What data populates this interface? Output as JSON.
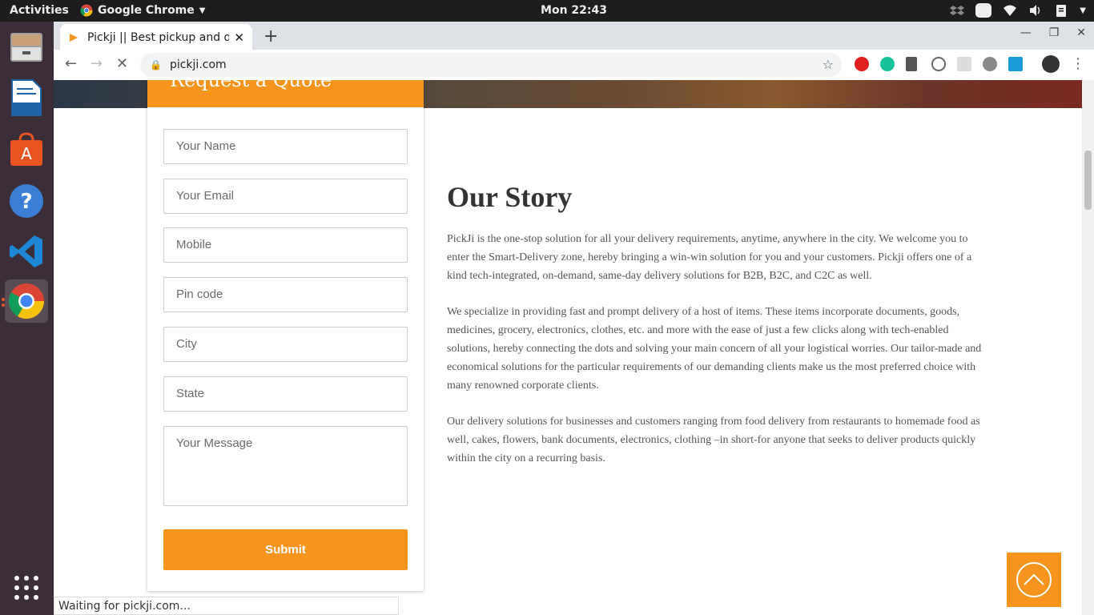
{
  "topbar": {
    "activities": "Activities",
    "app_name": "Google Chrome",
    "clock": "Mon 22:43"
  },
  "dock": {
    "items": [
      {
        "name": "Files"
      },
      {
        "name": "LibreOffice Writer"
      },
      {
        "name": "Ubuntu Software"
      },
      {
        "name": "Help"
      },
      {
        "name": "Visual Studio Code"
      },
      {
        "name": "Google Chrome"
      }
    ]
  },
  "browser": {
    "tab_title": "Pickji || Best pickup and de",
    "url": "pickji.com",
    "status": "Waiting for pickji.com..."
  },
  "form": {
    "heading": "Request a Quote",
    "fields": [
      "Your Name",
      "Your Email",
      "Mobile",
      "Pin code",
      "City",
      "State"
    ],
    "message_placeholder": "Your Message",
    "submit": "Submit"
  },
  "story": {
    "title": "Our Story",
    "paragraphs": [
      "PickJi is the one-stop solution for all your delivery requirements, anytime, anywhere in the city. We welcome you to enter the Smart-Delivery zone, hereby bringing a win-win solution for you and your customers. Pickji offers one of a kind tech-integrated, on-demand, same-day delivery solutions for B2B, B2C, and C2C as well.",
      "We specialize in providing fast and prompt delivery of a host of items. These items incorporate documents, goods, medicines, grocery, electronics, clothes, etc. and more with the ease of just a few clicks along with tech-enabled solutions, hereby connecting the dots and solving your main concern of all your logistical worries. Our tailor-made and economical solutions for the particular requirements of our demanding clients make us the most preferred choice with many renowned corporate clients.",
      "Our delivery solutions for businesses and customers ranging from food delivery from restaurants to homemade food as well, cakes, flowers, bank documents, electronics, clothing –in short-for anyone that seeks to deliver products quickly within the city on a recurring basis."
    ]
  },
  "colors": {
    "accent": "#f7941d",
    "dock_bg": "#3b2e38",
    "topbar_bg": "#1d1d1d"
  }
}
